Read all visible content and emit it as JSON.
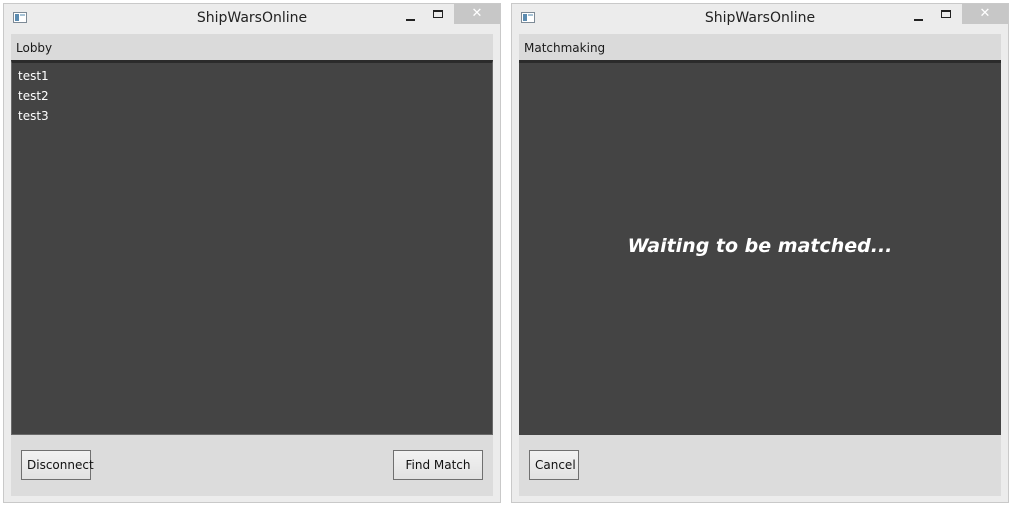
{
  "windows": [
    {
      "title": "ShipWarsOnline",
      "controls": {
        "close": "✕"
      },
      "panel_title": "Lobby",
      "lobby_players": [
        "test1",
        "test2",
        "test3"
      ],
      "buttons": {
        "left": "Disconnect",
        "right": "Find Match"
      }
    },
    {
      "title": "ShipWarsOnline",
      "controls": {
        "close": "✕"
      },
      "panel_title": "Matchmaking",
      "status_message": "Waiting to be matched...",
      "buttons": {
        "left": "Cancel"
      }
    }
  ],
  "colors": {
    "content_bg": "#444444",
    "header_bg": "#dadada",
    "window_bg": "#ececec",
    "close_button_bg": "#c7c7c7"
  },
  "icons": {
    "app": "window-app-icon",
    "minimize": "minimize-icon",
    "maximize": "maximize-icon",
    "close": "close-icon"
  }
}
